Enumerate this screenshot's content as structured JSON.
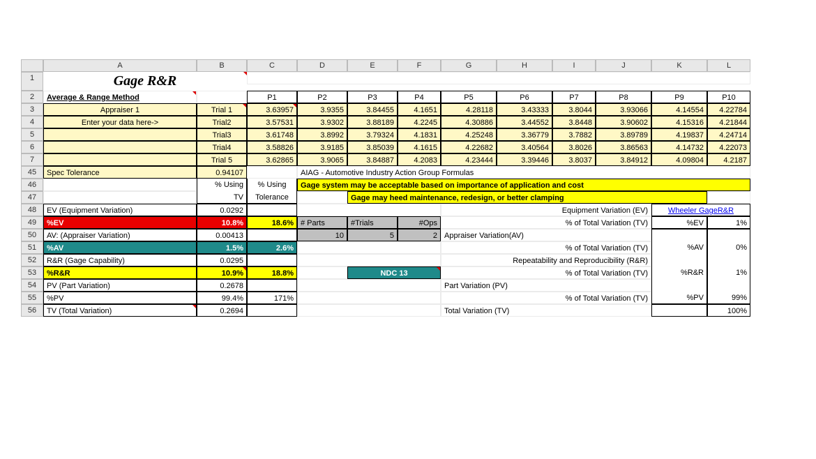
{
  "cols": [
    "",
    "A",
    "B",
    "C",
    "D",
    "E",
    "F",
    "G",
    "H",
    "I",
    "J",
    "K",
    "L"
  ],
  "title": "Gage R&R",
  "subtitle": "Average & Range Method",
  "parts": [
    "P1",
    "P2",
    "P3",
    "P4",
    "P5",
    "P6",
    "P7",
    "P8",
    "P9",
    "P10"
  ],
  "appraiser_label": "Appraiser 1",
  "enter_label": "Enter your data here->",
  "trials": [
    {
      "name": "Trial 1",
      "vals": [
        "3.63957",
        "3.9355",
        "3.84455",
        "4.1651",
        "4.28118",
        "3.43333",
        "3.8044",
        "3.93066",
        "4.14554",
        "4.22784"
      ]
    },
    {
      "name": "Trial2",
      "vals": [
        "3.57531",
        "3.9302",
        "3.88189",
        "4.2245",
        "4.30886",
        "3.44552",
        "3.8448",
        "3.90602",
        "4.15316",
        "4.21844"
      ]
    },
    {
      "name": "Trial3",
      "vals": [
        "3.61748",
        "3.8992",
        "3.79324",
        "4.1831",
        "4.25248",
        "3.36779",
        "3.7882",
        "3.89789",
        "4.19837",
        "4.24714"
      ]
    },
    {
      "name": "Trial4",
      "vals": [
        "3.58826",
        "3.9185",
        "3.85039",
        "4.1615",
        "4.22682",
        "3.40564",
        "3.8026",
        "3.86563",
        "4.14732",
        "4.22073"
      ]
    },
    {
      "name": "Trial 5",
      "vals": [
        "3.62865",
        "3.9065",
        "3.84887",
        "4.2083",
        "4.23444",
        "3.39446",
        "3.8037",
        "3.84912",
        "4.09804",
        "4.2187"
      ]
    }
  ],
  "spec_tol_label": "Spec Tolerance",
  "spec_tol_val": "0.94107",
  "aiag": "AIAG - Automotive Industry Action Group Formulas",
  "using_tv": "% Using",
  "tv": "TV",
  "using_tol": "% Using",
  "tol": "Tolerance",
  "msg1": "Gage system may be acceptable based on importance of application and cost",
  "msg2": "Gage may heed maintenance, redesign, or better clamping",
  "rows": {
    "ev_label": "EV (Equipment Variation)",
    "ev_val": "0.0292",
    "ev_desc": "Equipment Variation (EV)",
    "wheeler": "Wheeler GageR&R",
    "pev_label": "%EV",
    "pev_tv": "10.8%",
    "pev_tol": "18.6%",
    "nparts": "# Parts",
    "ntrials": "#Trials",
    "nops": "#Ops",
    "tot1": "% of Total Variation (TV)",
    "pev_k": "%EV",
    "pev_1": "1%",
    "av_label": "AV: (Appraiser Variation)",
    "av_val": "0.00413",
    "nparts_v": "10",
    "ntrials_v": "5",
    "nops_v": "2",
    "av_desc": "Appraiser Variation(AV)",
    "pav_label": "%AV",
    "pav_tv": "1.5%",
    "pav_tol": "2.6%",
    "tot2": "% of Total Variation (TV)",
    "pav_k": "%AV",
    "pav_0": "0%",
    "rr_label": "R&R (Gage Capability)",
    "rr_val": "0.0295",
    "rr_desc": "Repeatability and Reproducibility (R&R)",
    "prr_label": "%R&R",
    "prr_tv": "10.9%",
    "prr_tol": "18.8%",
    "ndc": "NDC  13",
    "tot3": "% of Total Variation (TV)",
    "prr_k": "%R&R",
    "prr_1": "1%",
    "pv_label": "PV (Part Variation)",
    "pv_val": "0.2678",
    "pv_desc": "Part Variation (PV)",
    "ppv_label": "%PV",
    "ppv_tv": "99.4%",
    "ppv_tol": "171%",
    "tot4": "% of Total Variation (TV)",
    "ppv_k": "%PV",
    "ppv_99": "99%",
    "tvlab": "TV (Total Variation)",
    "tvval": "0.2694",
    "tvdesc": "Total Variation (TV)",
    "tot100": "100%"
  },
  "rownums": [
    "1",
    "2",
    "3",
    "4",
    "5",
    "6",
    "7",
    "45",
    "46",
    "47",
    "48",
    "49",
    "50",
    "51",
    "52",
    "53",
    "54",
    "55",
    "56"
  ]
}
